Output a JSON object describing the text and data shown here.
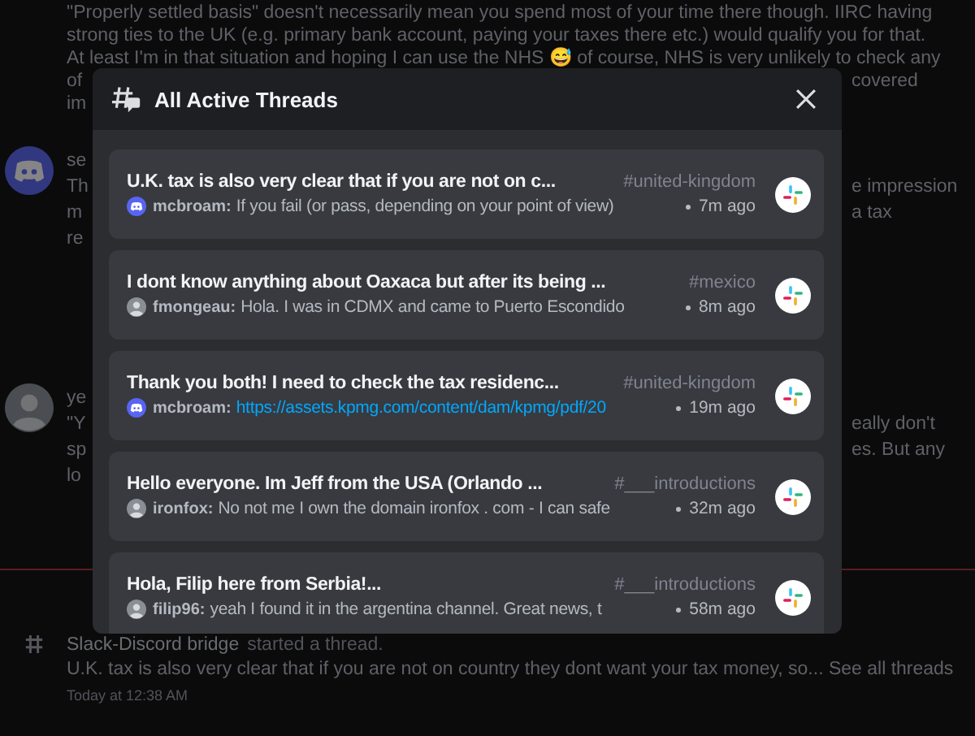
{
  "background_chat": {
    "messages": [
      {
        "lines": [
          {
            "left": "\"Properly settled basis\" doesn't necessarily mean you spend most of your time there though. IIRC having"
          },
          {
            "left": "strong ties to the UK (e.g. primary bank account, paying your taxes there etc.) would qualify you for that."
          },
          {
            "left": "At least I'm in that situation and hoping I can use the NHS 😅 of course, NHS is very unlikely to check any"
          },
          {
            "left": "of",
            "right": "covered"
          },
          {
            "left": "im"
          }
        ]
      },
      {
        "avatar": {
          "kind": "discord"
        },
        "lines": [
          {
            "left": "se"
          },
          {
            "left": "Th",
            "right": "e impression"
          },
          {
            "left": "m",
            "right": "a tax"
          },
          {
            "left": "re"
          }
        ]
      },
      {
        "avatar": {
          "kind": "photo"
        },
        "lines": [
          {
            "left": "ye"
          },
          {
            "left": "\"Y",
            "right": "eally don't"
          },
          {
            "left": "sp",
            "right": "es. But any"
          },
          {
            "left": "lo"
          }
        ]
      }
    ],
    "thread_notice": {
      "author": "Slack-Discord bridge",
      "action": "started a thread.",
      "preview": "U.K. tax is also very clear that if you are not on country they dont want your tax money, so...",
      "link": "See all threads",
      "time": "Today at 12:38 AM"
    }
  },
  "modal": {
    "title": "All Active Threads",
    "threads": [
      {
        "title": "U.K. tax is also very clear that if you are not on c...",
        "channel": "#united-kingdom",
        "avatar": {
          "kind": "discord"
        },
        "author": "mcbroam:",
        "message": "If you fail (or pass, depending on your point of view)",
        "kind": "text",
        "time": "7m ago"
      },
      {
        "title": "I dont know anything about Oaxaca but after its being ...",
        "channel": "#mexico",
        "avatar": {
          "kind": "photo"
        },
        "author": "fmongeau:",
        "message": "Hola. I was in CDMX and came to Puerto Escondido",
        "kind": "text",
        "time": "8m ago"
      },
      {
        "title": "Thank you both! I need to check the tax residenc...",
        "channel": "#united-kingdom",
        "avatar": {
          "kind": "discord"
        },
        "author": "mcbroam:",
        "message": "https://assets.kpmg.com/content/dam/kpmg/pdf/20",
        "kind": "link",
        "time": "19m ago"
      },
      {
        "title": "Hello everyone. Im Jeff from the USA (Orlando ...",
        "channel": "#___introductions",
        "avatar": {
          "kind": "photo"
        },
        "author": "ironfox:",
        "message": "No not me I own the domain ironfox . com - I can safe",
        "kind": "text",
        "time": "32m ago"
      },
      {
        "title": "Hola, Filip here from Serbia!...",
        "channel": "#___introductions",
        "avatar": {
          "kind": "photo"
        },
        "author": "filip96:",
        "message": "yeah I found it in the argentina channel. Great news, t",
        "kind": "text",
        "time": "58m ago"
      }
    ]
  }
}
